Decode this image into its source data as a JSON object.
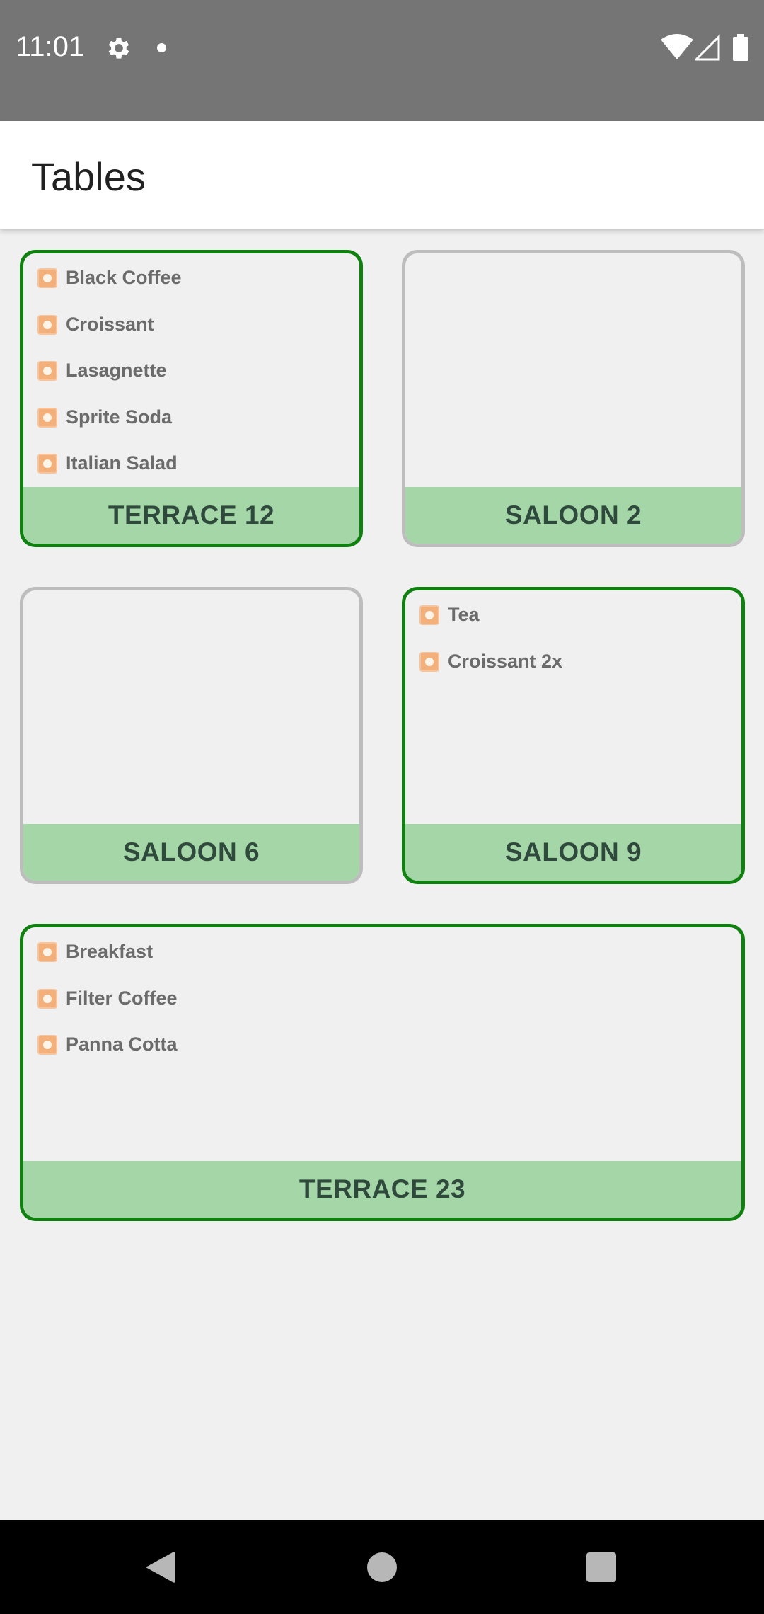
{
  "status_bar": {
    "time": "11:01",
    "icons": [
      "gear-icon",
      "notification-dot-icon",
      "wifi-icon",
      "signal-icon",
      "battery-icon"
    ]
  },
  "app_bar": {
    "title": "Tables"
  },
  "colors": {
    "occupied_border": "#108010",
    "free_border": "#bdbdbd",
    "footer_bg": "#a5d6a7",
    "item_icon": "#f4b07a"
  },
  "tables": [
    {
      "name": "TERRACE 12",
      "status": "occupied",
      "items": [
        "Black Coffee",
        "Croissant",
        "Lasagnette",
        "Sprite Soda",
        "Italian Salad"
      ]
    },
    {
      "name": "SALOON 2",
      "status": "free",
      "items": []
    },
    {
      "name": "SALOON 6",
      "status": "free",
      "items": []
    },
    {
      "name": "SALOON 9",
      "status": "occupied",
      "items": [
        "Tea",
        "Croissant 2x"
      ]
    },
    {
      "name": "TERRACE 23",
      "status": "occupied",
      "items": [
        "Breakfast",
        "Filter Coffee",
        "Panna Cotta"
      ]
    }
  ],
  "nav_bar": {
    "icons": [
      "back-icon",
      "home-icon",
      "recents-icon"
    ]
  }
}
